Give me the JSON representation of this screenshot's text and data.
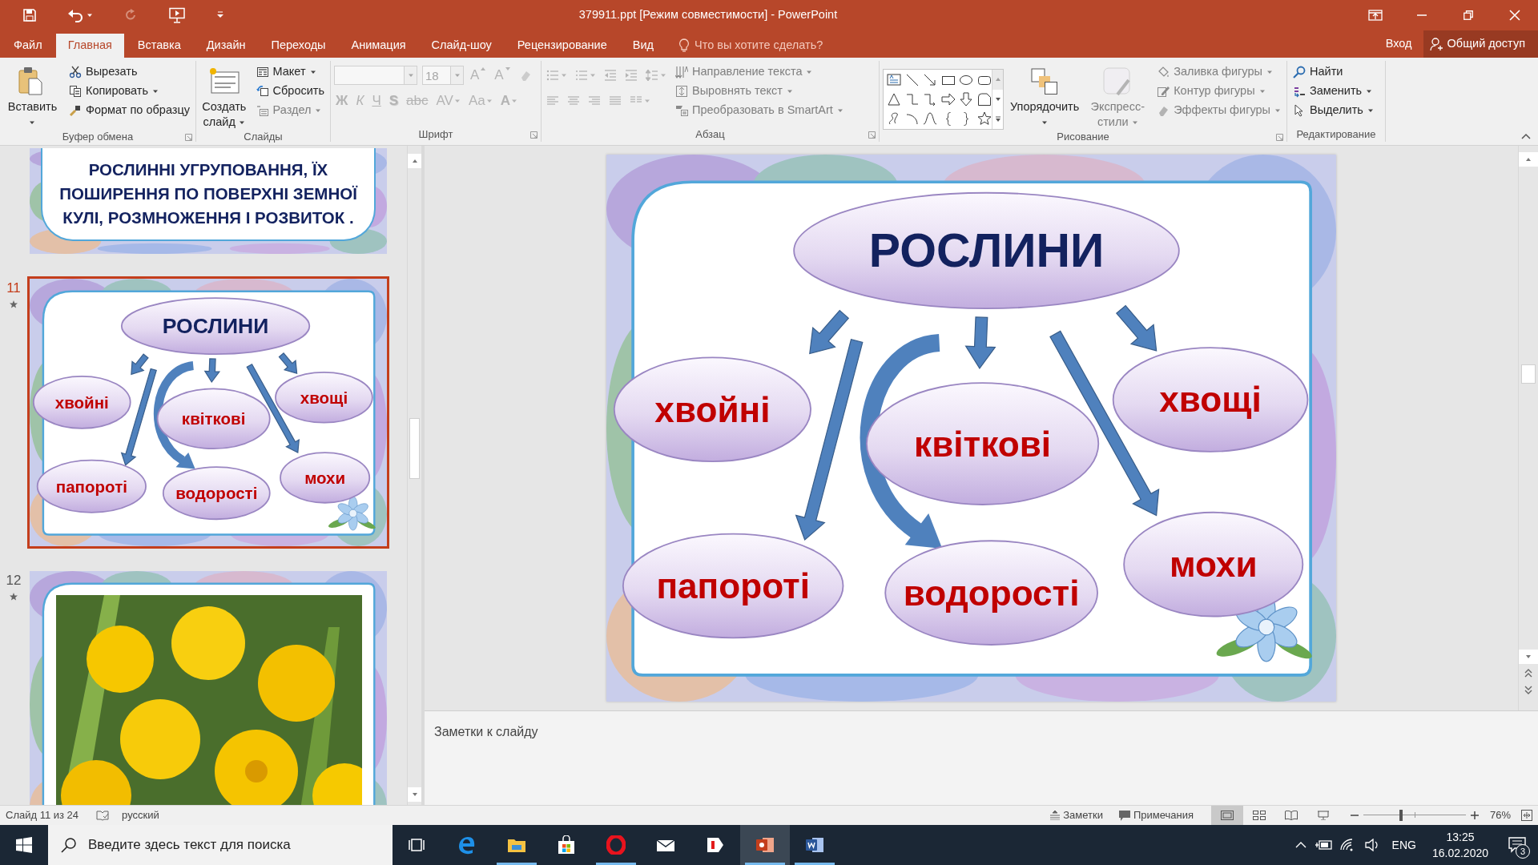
{
  "window": {
    "title": "379911.ppt [Режим совместимости] - PowerPoint",
    "sign_in": "Вход",
    "share": "Общий доступ"
  },
  "quick_access": [
    {
      "kind": "save",
      "disabled": false
    },
    {
      "kind": "undo",
      "disabled": false
    },
    {
      "kind": "redo",
      "disabled": true
    },
    {
      "kind": "present",
      "disabled": false
    },
    {
      "kind": "customize",
      "disabled": false
    }
  ],
  "tabs": [
    {
      "label": "Файл",
      "selected": false
    },
    {
      "label": "Главная",
      "selected": true
    },
    {
      "label": "Вставка",
      "selected": false
    },
    {
      "label": "Дизайн",
      "selected": false
    },
    {
      "label": "Переходы",
      "selected": false
    },
    {
      "label": "Анимация",
      "selected": false
    },
    {
      "label": "Слайд-шоу",
      "selected": false
    },
    {
      "label": "Рецензирование",
      "selected": false
    },
    {
      "label": "Вид",
      "selected": false
    }
  ],
  "tell_me": {
    "placeholder": "Что вы хотите сделать?"
  },
  "ribbon": {
    "groups": [
      {
        "label": "Буфер обмена",
        "launcher": true,
        "columns": [
          {
            "items": [
              {
                "kind": "big",
                "label": "Вставить",
                "menu": true,
                "disabled": false
              }
            ]
          },
          {
            "items": [
              {
                "kind": "small",
                "label": "Вырезать",
                "menu": false,
                "disabled": false
              },
              {
                "kind": "small",
                "label": "Копировать",
                "menu": true,
                "disabled": false
              },
              {
                "kind": "small",
                "label": "Формат по образцу",
                "menu": false,
                "disabled": false
              }
            ]
          }
        ]
      },
      {
        "label": "Слайды",
        "launcher": false,
        "columns": [
          {
            "items": [
              {
                "kind": "big",
                "label": "Создать слайд",
                "menu": true,
                "disabled": false
              }
            ]
          },
          {
            "items": [
              {
                "kind": "small",
                "label": "Макет",
                "menu": true,
                "disabled": false
              },
              {
                "kind": "small",
                "label": "Сбросить",
                "menu": false,
                "disabled": false
              },
              {
                "kind": "small",
                "label": "Раздел",
                "menu": true,
                "disabled": true
              }
            ]
          }
        ]
      },
      {
        "label": "Шрифт",
        "launcher": true,
        "columns": [
          {
            "items": [
              {
                "kind": "row",
                "buttons": [
                  {
                    "kind": "field",
                    "disabled": true
                  },
                  {
                    "kind": "field",
                    "value": "18",
                    "disabled": true
                  },
                  {
                    "kind": "glyph",
                    "label": "A",
                    "disabled": true
                  },
                  {
                    "kind": "glyph",
                    "label": "A",
                    "disabled": true
                  },
                  {
                    "kind": "icon",
                    "disabled": true
                  }
                ]
              },
              {
                "kind": "row",
                "buttons": [
                  {
                    "kind": "glyph",
                    "label": "Ж",
                    "disabled": true
                  },
                  {
                    "kind": "glyph",
                    "label": "К",
                    "disabled": true
                  },
                  {
                    "kind": "glyph",
                    "label": "Ч",
                    "disabled": true
                  },
                  {
                    "kind": "glyph",
                    "label": "S",
                    "disabled": true
                  },
                  {
                    "kind": "glyph",
                    "label": "abc",
                    "disabled": true
                  },
                  {
                    "kind": "glyph",
                    "label": "AV",
                    "menu": true,
                    "disabled": true
                  },
                  {
                    "kind": "glyph",
                    "label": "Aa",
                    "menu": true,
                    "disabled": true
                  },
                  {
                    "kind": "glyph",
                    "label": "A",
                    "menu": true,
                    "disabled": true
                  }
                ]
              }
            ]
          }
        ]
      },
      {
        "label": "Абзац",
        "launcher": true,
        "columns": [
          {
            "items": [
              {
                "kind": "row",
                "buttons": [
                  {
                    "kind": "icon",
                    "menu": true,
                    "disabled": true
                  },
                  {
                    "kind": "icon",
                    "menu": true,
                    "disabled": true
                  },
                  {
                    "kind": "icon",
                    "disabled": true
                  },
                  {
                    "kind": "icon",
                    "disabled": true
                  },
                  {
                    "kind": "icon",
                    "menu": true,
                    "disabled": true
                  }
                ]
              },
              {
                "kind": "row",
                "buttons": [
                  {
                    "kind": "icon",
                    "disabled": true
                  },
                  {
                    "kind": "icon",
                    "disabled": true
                  },
                  {
                    "kind": "icon",
                    "disabled": true
                  },
                  {
                    "kind": "icon",
                    "disabled": true
                  },
                  {
                    "kind": "icon",
                    "menu": true,
                    "disabled": true
                  }
                ]
              }
            ]
          },
          {
            "items": [
              {
                "kind": "small",
                "label": "Направление текста",
                "menu": true,
                "disabled": true
              },
              {
                "kind": "small",
                "label": "Выровнять текст",
                "menu": true,
                "disabled": true
              },
              {
                "kind": "small",
                "label": "Преобразовать в SmartArt",
                "menu": true,
                "disabled": true
              }
            ]
          }
        ]
      },
      {
        "label": "Рисование",
        "launcher": true,
        "columns": [
          {
            "items": [
              {
                "kind": "gallery"
              }
            ]
          },
          {
            "items": [
              {
                "kind": "big",
                "label": "Упорядочить",
                "menu": true,
                "disabled": false
              }
            ]
          },
          {
            "items": [
              {
                "kind": "big",
                "label": "Экспресс-стили",
                "menu": true,
                "disabled": true
              }
            ]
          },
          {
            "items": [
              {
                "kind": "small",
                "label": "Заливка фигуры",
                "menu": true,
                "disabled": true
              },
              {
                "kind": "small",
                "label": "Контур фигуры",
                "menu": true,
                "disabled": true
              },
              {
                "kind": "small",
                "label": "Эффекты фигуры",
                "menu": true,
                "disabled": true
              }
            ]
          }
        ]
      },
      {
        "label": "Редактирование",
        "launcher": false,
        "columns": [
          {
            "items": [
              {
                "kind": "small",
                "label": "Найти",
                "menu": false,
                "disabled": false
              },
              {
                "kind": "small",
                "label": "Заменить",
                "menu": true,
                "disabled": false
              },
              {
                "kind": "small",
                "label": "Выделить",
                "menu": true,
                "disabled": false
              }
            ]
          }
        ]
      }
    ]
  },
  "thumbnails": [
    {
      "kind": "text",
      "selected": false,
      "text": "РОСЛИННІ УГРУПОВАННЯ, ЇХ\nПОШИРЕННЯ ПО ПОВЕРХНІ ЗЕМНОЇ\nКУЛІ, РОЗМНОЖЕННЯ І РОЗВИТОК ."
    },
    {
      "kind": "diagram",
      "number": "11",
      "selected": true,
      "animated": true,
      "title": "РОСЛИНИ",
      "groups": [
        "хвойні",
        "квіткові",
        "хвощі",
        "папороті",
        "водорості",
        "мохи"
      ]
    },
    {
      "kind": "picture",
      "number": "12",
      "selected": false,
      "animated": true
    }
  ],
  "slide": {
    "title": "РОСЛИНИ",
    "groups": [
      "хвойні",
      "квіткові",
      "хвощі",
      "папороті",
      "водорості",
      "мохи"
    ]
  },
  "notes": {
    "placeholder": "Заметки к слайду"
  },
  "status_bar": {
    "slide_info": "Слайд 11 из 24",
    "language": "русский",
    "notes_button": "Заметки",
    "comments_button": "Примечания",
    "views": [
      {
        "kind": "normal",
        "selected": true
      },
      {
        "kind": "sorter",
        "selected": false
      },
      {
        "kind": "reading",
        "selected": false
      },
      {
        "kind": "slideshow",
        "selected": false
      }
    ],
    "zoom": {
      "level": 0.37,
      "reading": "76%"
    }
  },
  "taskbar": {
    "search": {
      "placeholder": "Введите здесь текст для поиска"
    },
    "apps": [
      {
        "kind": "taskview",
        "running": false,
        "selected": false
      },
      {
        "kind": "edge",
        "running": false,
        "selected": false
      },
      {
        "kind": "explorer",
        "running": true,
        "selected": false
      },
      {
        "kind": "store",
        "running": false,
        "selected": false
      },
      {
        "kind": "opera",
        "running": true,
        "selected": false
      },
      {
        "kind": "mail",
        "running": false,
        "selected": false
      },
      {
        "kind": "yandex",
        "running": false,
        "selected": false
      },
      {
        "kind": "powerpoint",
        "running": true,
        "selected": true
      },
      {
        "kind": "word",
        "running": true,
        "selected": false
      }
    ],
    "language": "ENG",
    "time": "13:25",
    "date": "16.02.2020",
    "notification_count": "3"
  }
}
